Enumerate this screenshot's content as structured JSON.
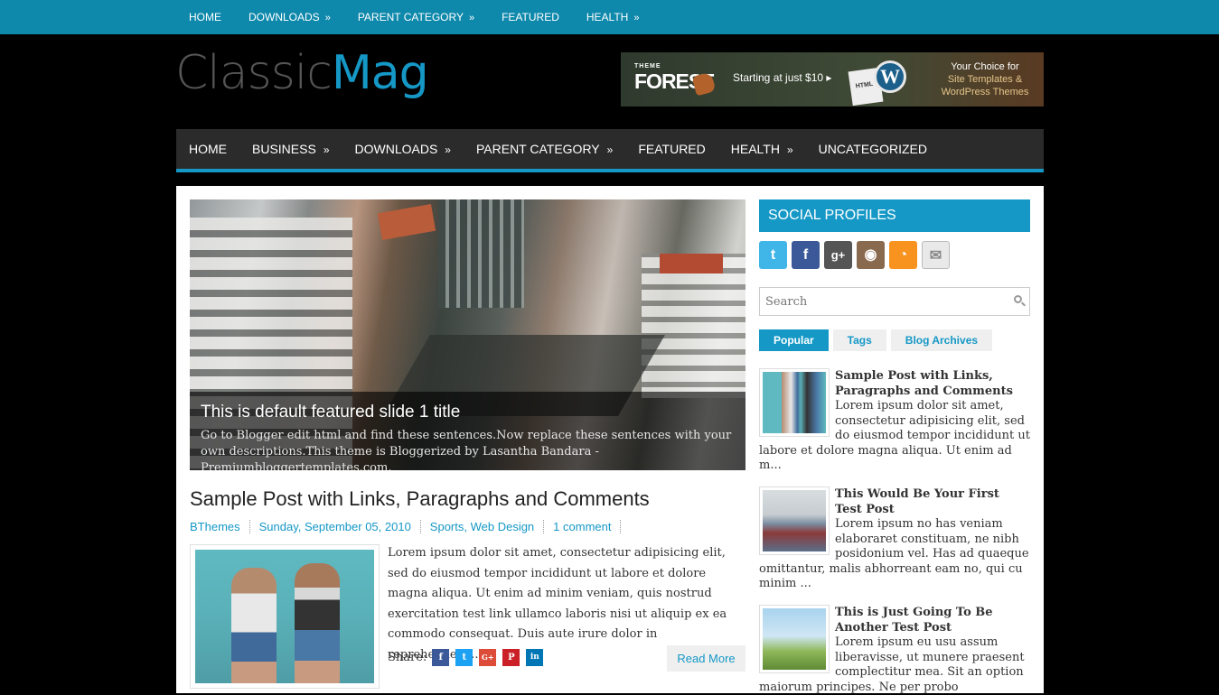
{
  "topnav": {
    "items": [
      {
        "label": "HOME",
        "arrow": ""
      },
      {
        "label": "DOWNLOADS",
        "arrow": "»"
      },
      {
        "label": "PARENT CATEGORY",
        "arrow": "»"
      },
      {
        "label": "FEATURED",
        "arrow": ""
      },
      {
        "label": "HEALTH",
        "arrow": "»"
      }
    ]
  },
  "logo": {
    "part1": "Classic",
    "part2": "Mag"
  },
  "ad": {
    "brand_small": "THEME",
    "brand": "FOREST",
    "tagline": "Starting at just $10  ▸",
    "paper_label": "HTML",
    "wp_letter": "W",
    "choice_line1": "Your Choice for",
    "choice_line2": "Site Templates &",
    "choice_line3": "WordPress Themes"
  },
  "mainnav": {
    "items": [
      {
        "label": "HOME",
        "arrow": ""
      },
      {
        "label": "BUSINESS",
        "arrow": "»"
      },
      {
        "label": "DOWNLOADS",
        "arrow": "»"
      },
      {
        "label": "PARENT CATEGORY",
        "arrow": "»"
      },
      {
        "label": "FEATURED",
        "arrow": ""
      },
      {
        "label": "HEALTH",
        "arrow": "»"
      },
      {
        "label": "UNCATEGORIZED",
        "arrow": ""
      }
    ]
  },
  "slider": {
    "title": "This is default featured slide 1 title",
    "text": "Go to Blogger edit html and find these sentences.Now replace these sentences with your own descriptions.This theme is Bloggerized by Lasantha Bandara - Premiumbloggertemplates.com."
  },
  "post": {
    "title": "Sample Post with Links, Paragraphs and Comments",
    "author": "BThemes",
    "date": "Sunday, September 05, 2010",
    "labels": "Sports, Web Design",
    "comments": "1 comment",
    "excerpt": "Lorem ipsum dolor sit amet, consectetur adipisicing elit, sed do eiusmod tempor incididunt ut labore et dolore magna aliqua. Ut enim ad minim veniam, quis nostrud exercitation test link ullamco laboris nisi ut aliquip ex ea commodo consequat. Duis aute irure dolor in reprehenderit...",
    "share_label": "Share:",
    "share_buttons": [
      {
        "icon": "facebook-icon",
        "glyph": "f",
        "color": "#3b5998"
      },
      {
        "icon": "twitter-icon",
        "glyph": "t",
        "color": "#1da1f2"
      },
      {
        "icon": "google-plus-icon",
        "glyph": "G+",
        "color": "#dd4b39"
      },
      {
        "icon": "pinterest-icon",
        "glyph": "P",
        "color": "#cb2027"
      },
      {
        "icon": "linkedin-icon",
        "glyph": "in",
        "color": "#0077b5"
      }
    ],
    "read_more": "Read More"
  },
  "sidebar": {
    "social_title": "SOCIAL PROFILES",
    "social_icons": [
      {
        "icon": "twitter-icon",
        "glyph": "t",
        "color": "#3fb5e8"
      },
      {
        "icon": "facebook-icon",
        "glyph": "f",
        "color": "#3b5998"
      },
      {
        "icon": "google-plus-icon",
        "glyph": "g+",
        "color": "#555555"
      },
      {
        "icon": "instagram-icon",
        "glyph": "◉",
        "color": "#8a6a4e"
      },
      {
        "icon": "rss-icon",
        "glyph": "◔",
        "color": "#f7931e"
      },
      {
        "icon": "email-icon",
        "glyph": "✉",
        "color": "#e9e9e9"
      }
    ],
    "search_placeholder": "Search",
    "tabs": [
      "Popular",
      "Tags",
      "Blog Archives"
    ],
    "popular": [
      {
        "title": "Sample Post with Links, Paragraphs and Comments",
        "text": "Lorem ipsum dolor sit amet, consectetur adipisicing elit, sed do eiusmod tempor incididunt ut labore et dolore magna aliqua. Ut enim ad m..."
      },
      {
        "title": "This Would Be Your First Test Post",
        "text": "Lorem ipsum no has veniam elaboraret constituam, ne nibh posidonium vel. Has ad quaeque omittantur, malis abhorreant eam no, qui cu minim ..."
      },
      {
        "title": "This is Just Going To Be Another Test Post",
        "text": "Lorem ipsum eu usu assum liberavisse, ut munere praesent complectitur mea. Sit an option maiorum principes. Ne per probo"
      }
    ]
  }
}
